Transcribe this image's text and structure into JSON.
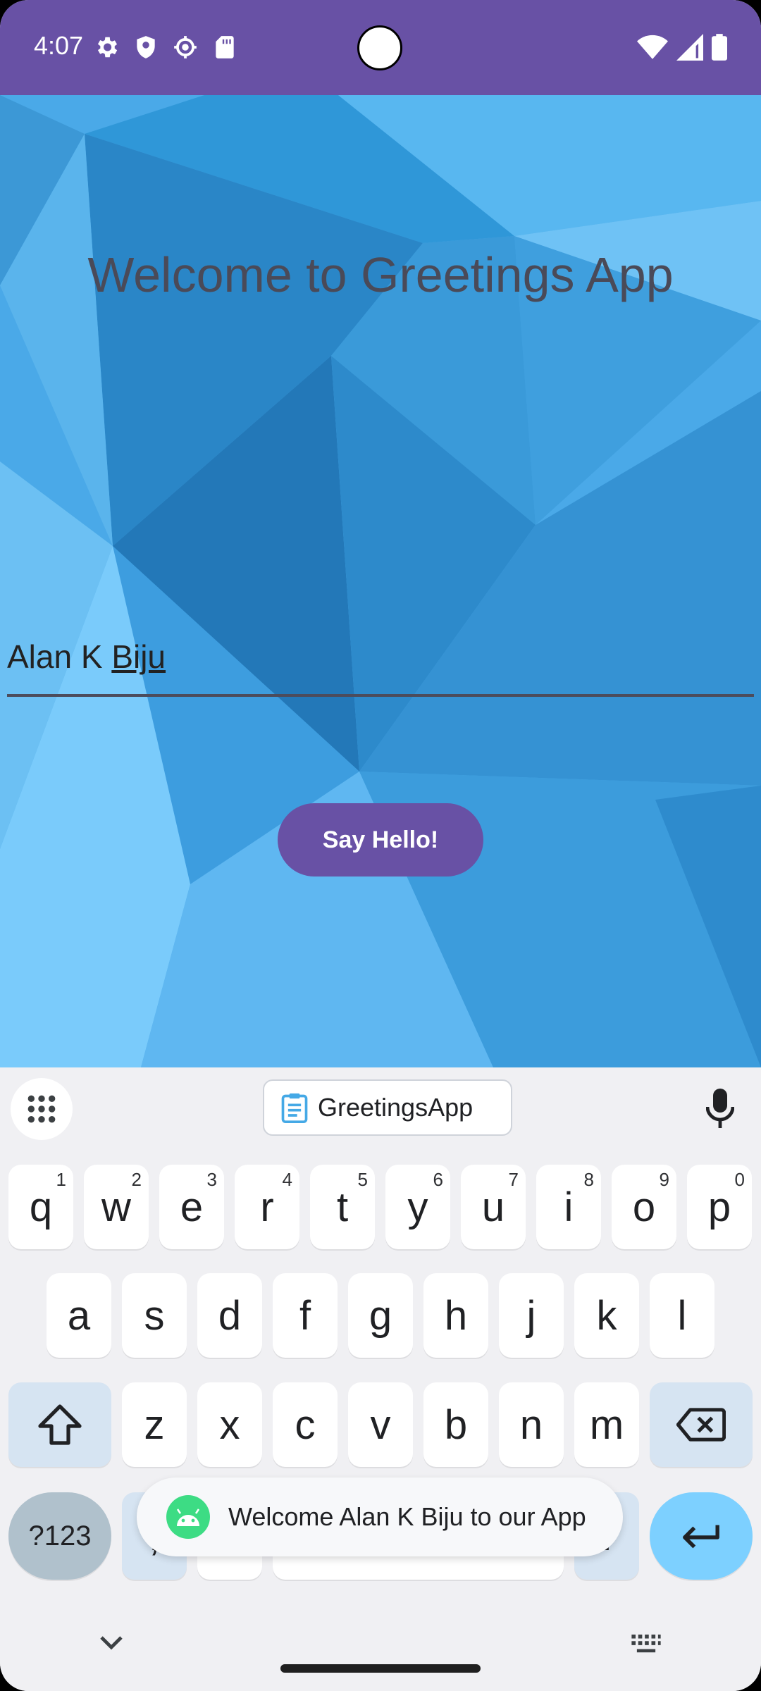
{
  "status_bar": {
    "time": "4:07",
    "left_icons": [
      "gear-icon",
      "shield-icon",
      "bug-icon",
      "sd-card-icon"
    ],
    "right_icons": [
      "wifi-icon",
      "signal-icon",
      "battery-icon"
    ],
    "background": "#6851a5"
  },
  "app": {
    "title": "Welcome to Greetings App",
    "name_input": {
      "value_first": "Alan K ",
      "value_underlined": "Biju"
    },
    "say_hello_label": "Say Hello!",
    "accent": "#6851a5"
  },
  "keyboard": {
    "clipboard_chip": "GreetingsApp",
    "row1": [
      {
        "k": "q",
        "h": "1"
      },
      {
        "k": "w",
        "h": "2"
      },
      {
        "k": "e",
        "h": "3"
      },
      {
        "k": "r",
        "h": "4"
      },
      {
        "k": "t",
        "h": "5"
      },
      {
        "k": "y",
        "h": "6"
      },
      {
        "k": "u",
        "h": "7"
      },
      {
        "k": "i",
        "h": "8"
      },
      {
        "k": "o",
        "h": "9"
      },
      {
        "k": "p",
        "h": "0"
      }
    ],
    "row2": [
      "a",
      "s",
      "d",
      "f",
      "g",
      "h",
      "j",
      "k",
      "l"
    ],
    "row3": [
      "z",
      "x",
      "c",
      "v",
      "b",
      "n",
      "m"
    ],
    "symbols_label": "?123",
    "comma_label": ",",
    "period_label": "."
  },
  "toast": {
    "text": "Welcome Alan K Biju to our App"
  }
}
